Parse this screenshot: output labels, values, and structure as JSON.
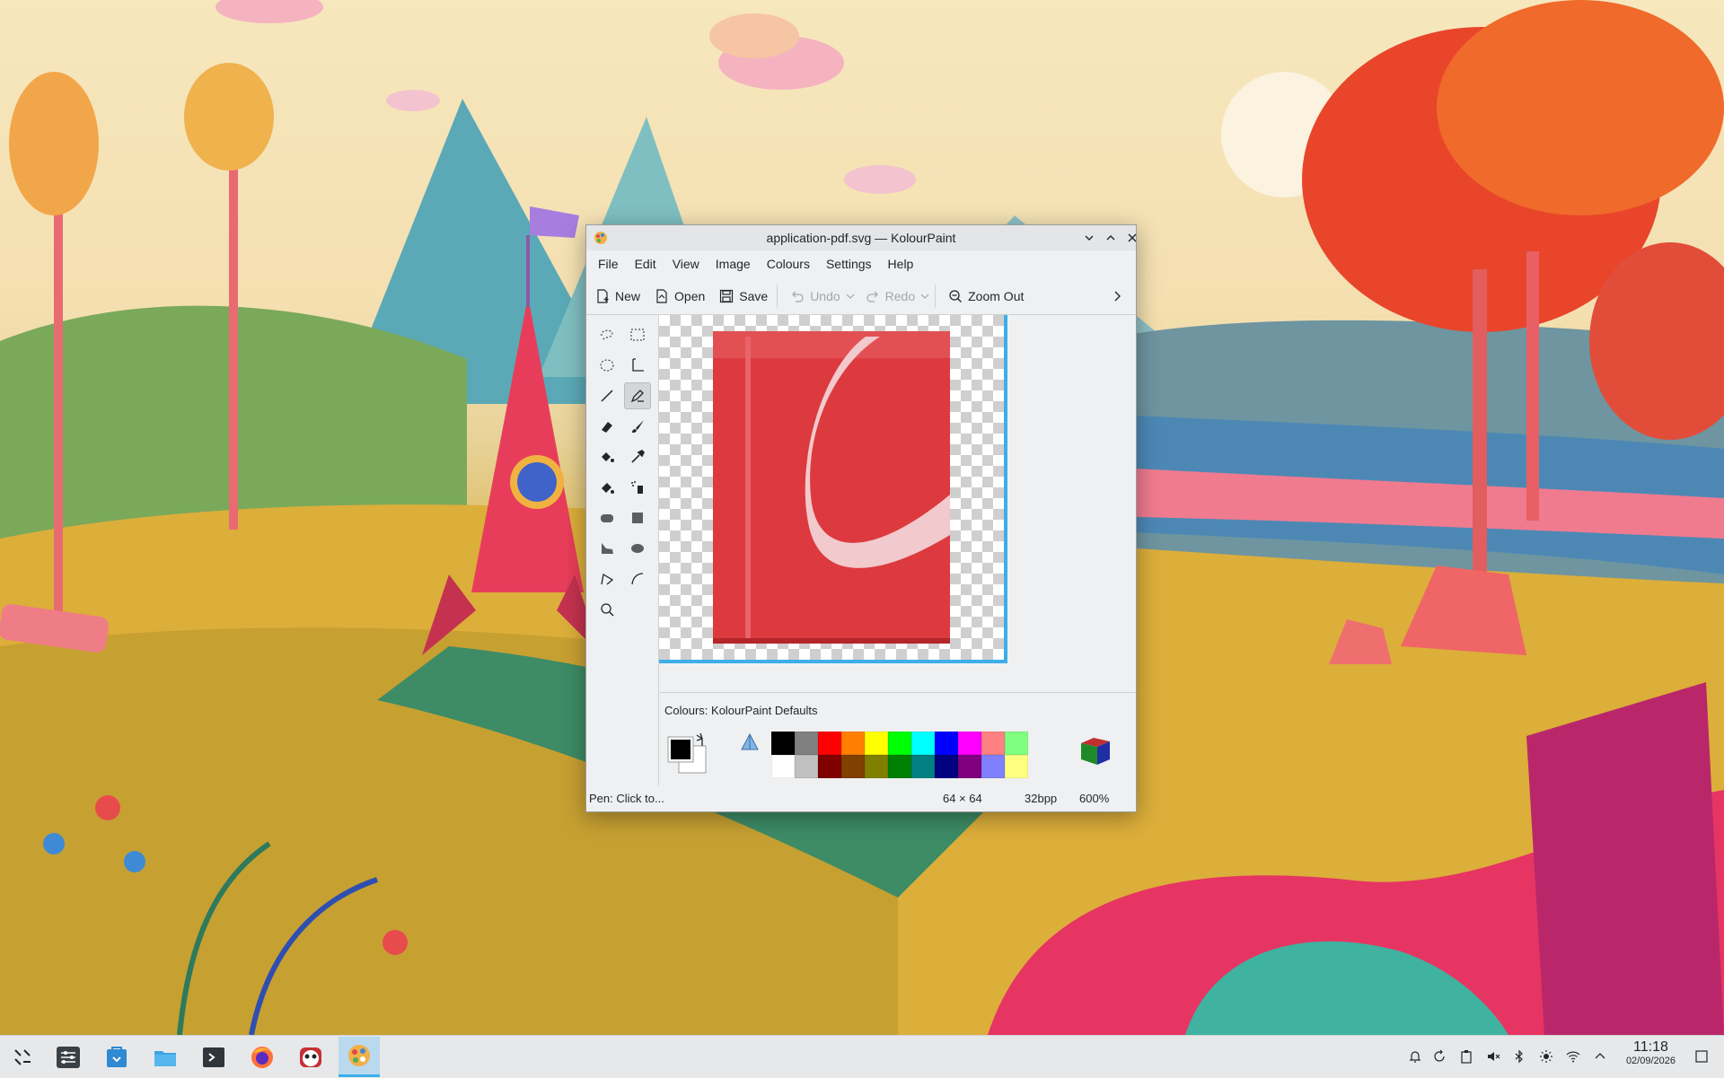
{
  "window": {
    "title": "application-pdf.svg — KolourPaint",
    "controls": [
      "minimize",
      "maximize",
      "close"
    ]
  },
  "menubar": {
    "items": [
      "File",
      "Edit",
      "View",
      "Image",
      "Colours",
      "Settings",
      "Help"
    ]
  },
  "toolbar": {
    "new_label": "New",
    "open_label": "Open",
    "save_label": "Save",
    "undo_label": "Undo",
    "redo_label": "Redo",
    "zoom_out_label": "Zoom Out"
  },
  "tools": [
    "free-form-selection",
    "rectangular-selection",
    "elliptical-selection",
    "text",
    "line",
    "pen",
    "eraser",
    "brush",
    "flood-fill",
    "color-picker",
    "color-eraser",
    "spraycan",
    "rounded-rectangle",
    "rectangle",
    "polygon",
    "ellipse",
    "connected-lines",
    "curve",
    "zoom"
  ],
  "palette": {
    "title": "Colours: KolourPaint Defaults",
    "colors_row1": [
      "#000000",
      "#808080",
      "#ff0000",
      "#ff8000",
      "#ffff00",
      "#00ff00",
      "#00ffff",
      "#0000ff",
      "#ff00ff",
      "#ff8080",
      "#80ff80"
    ],
    "colors_row2": [
      "#ffffff",
      "#c0c0c0",
      "#800000",
      "#804000",
      "#808000",
      "#008000",
      "#008080",
      "#000080",
      "#800080",
      "#8080ff",
      "#ffff80"
    ],
    "foreground": "#000000",
    "background": "#ffffff"
  },
  "statusbar": {
    "message": "Pen: Click to...",
    "size": "64 × 64",
    "depth": "32bpp",
    "zoom": "600%"
  },
  "taskbar": {
    "apps": [
      "application-launcher",
      "system-settings",
      "discover",
      "dolphin",
      "konsole",
      "firefox",
      "ksysguard",
      "kolourpaint"
    ],
    "clock_time": "11:18",
    "clock_date": "02/09/2026"
  }
}
